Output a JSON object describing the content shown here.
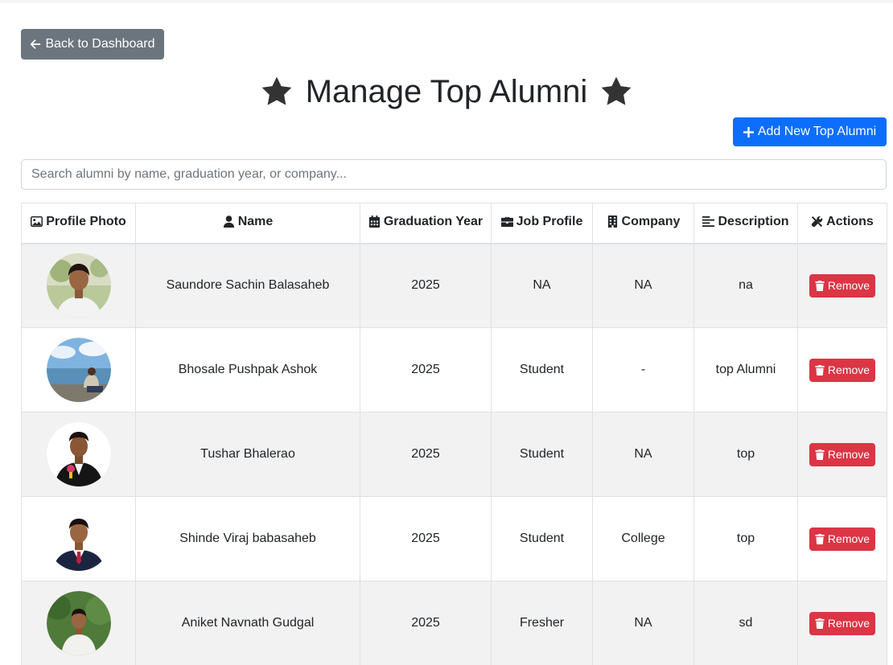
{
  "nav": {
    "back_label": "Back to Dashboard"
  },
  "page": {
    "title": "Manage Top Alumni"
  },
  "toolbar": {
    "add_label": "Add New Top Alumni"
  },
  "search": {
    "placeholder": "Search alumni by name, graduation year, or company..."
  },
  "table": {
    "headers": [
      "Profile Photo",
      "Name",
      "Graduation Year",
      "Job Profile",
      "Company",
      "Description",
      "Actions"
    ],
    "rows": [
      {
        "name": "Saundore Sachin Balasaheb",
        "year": "2025",
        "job": "NA",
        "company": "NA",
        "description": "na",
        "action": "Remove"
      },
      {
        "name": "Bhosale Pushpak Ashok",
        "year": "2025",
        "job": "Student",
        "company": "-",
        "description": "top Alumni",
        "action": "Remove"
      },
      {
        "name": "Tushar Bhalerao",
        "year": "2025",
        "job": "Student",
        "company": "NA",
        "description": "top",
        "action": "Remove"
      },
      {
        "name": "Shinde Viraj babasaheb",
        "year": "2025",
        "job": "Student",
        "company": "College",
        "description": "top",
        "action": "Remove"
      },
      {
        "name": "Aniket Navnath Gudgal",
        "year": "2025",
        "job": "Fresher",
        "company": "NA",
        "description": "sd",
        "action": "Remove"
      }
    ]
  },
  "colors": {
    "primary": "#0d6efd",
    "secondary": "#6c757d",
    "danger": "#dc3545",
    "stripe": "#f2f2f2"
  }
}
